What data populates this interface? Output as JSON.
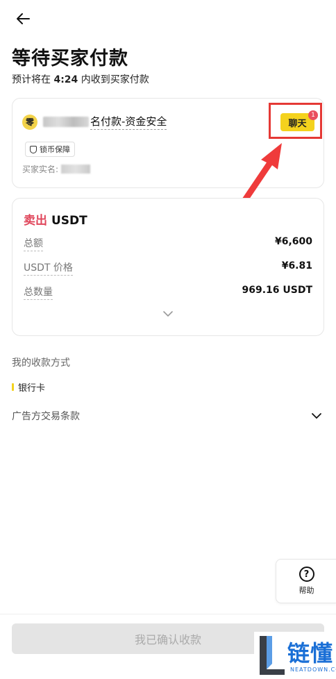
{
  "header": {
    "back_icon": "arrow-left-icon",
    "title": "等待买家付款",
    "subtitle_prefix": "预计将在 ",
    "subtitle_time": "4:24",
    "subtitle_suffix": " 内收到买家付款"
  },
  "seller_card": {
    "avatar_char": "零",
    "name_visible": "名付款-资金安全",
    "guard_label": "锁币保障",
    "buyer_label": "买家实名:",
    "chat_label": "聊天",
    "chat_badge": "1"
  },
  "order": {
    "side": "卖出",
    "asset": "USDT",
    "rows": [
      {
        "label": "总额",
        "value": "¥6,600"
      },
      {
        "label": "USDT 价格",
        "value": "¥6.81"
      },
      {
        "label": "总数量",
        "value": "969.16 USDT"
      }
    ]
  },
  "payment": {
    "label": "我的收款方式",
    "method": "银行卡",
    "terms_label": "广告方交易条款"
  },
  "help": {
    "label": "帮助",
    "icon": "question-icon"
  },
  "confirm_button": "我已确认收款",
  "watermark": {
    "text": "链懂",
    "sub": "NEATDOWN.COM"
  },
  "colors": {
    "accent_yellow": "#f4d21d",
    "sell_red": "#e0475c",
    "highlight_red": "#e53935"
  }
}
